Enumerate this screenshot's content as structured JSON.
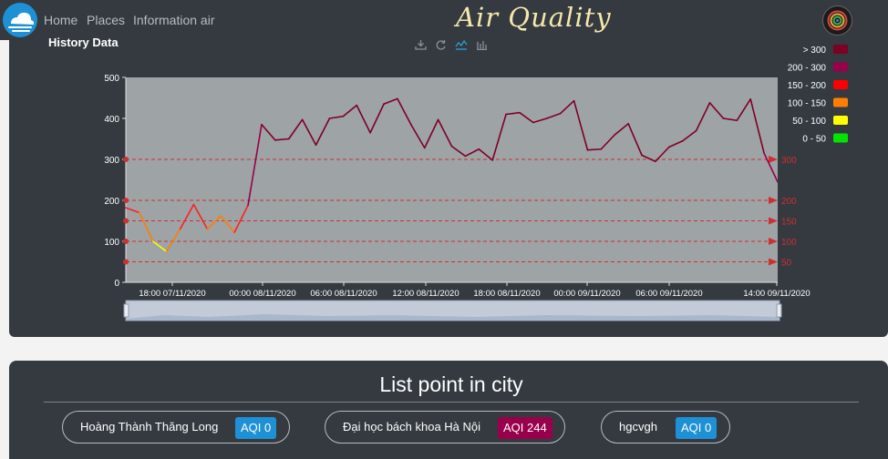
{
  "navbar": {
    "links": [
      "Home",
      "Places",
      "Information air"
    ],
    "brand": "Air Quality"
  },
  "history": {
    "title": "History Data",
    "toolbox": [
      "download-icon",
      "refresh-icon",
      "line-chart-icon",
      "bar-chart-icon"
    ]
  },
  "chart_data": {
    "type": "line",
    "y_ticks": [
      0,
      100,
      200,
      300,
      400,
      500
    ],
    "ylim": [
      0,
      500
    ],
    "x_tick_labels": [
      "18:00 07/11/2020",
      "00:00 08/11/2020",
      "06:00 08/11/2020",
      "12:00 08/11/2020",
      "18:00 08/11/2020",
      "00:00 09/11/2020",
      "06:00 09/11/2020",
      "14:00 09/11/2020"
    ],
    "values": [
      182,
      170,
      100,
      75,
      130,
      190,
      130,
      162,
      122,
      188,
      385,
      347,
      350,
      397,
      335,
      400,
      405,
      432,
      365,
      435,
      448,
      385,
      328,
      397,
      332,
      308,
      325,
      298,
      410,
      414,
      390,
      400,
      412,
      443,
      323,
      325,
      360,
      387,
      310,
      295,
      330,
      345,
      370,
      438,
      400,
      395,
      447,
      315,
      245
    ],
    "mark_lines": [
      {
        "value": 300,
        "label": "300"
      },
      {
        "value": 200,
        "label": "200"
      },
      {
        "value": 150,
        "label": "150"
      },
      {
        "value": 100,
        "label": "100"
      },
      {
        "value": 50,
        "label": "50"
      }
    ],
    "legend": [
      {
        "label": "> 300",
        "color": "#7e0023"
      },
      {
        "label": "200 - 300",
        "color": "#99004c"
      },
      {
        "label": "150 - 200",
        "color": "#ff0000"
      },
      {
        "label": "100 - 150",
        "color": "#ff7e00"
      },
      {
        "label": "50 - 100",
        "color": "#ffff00"
      },
      {
        "label": "0 - 50",
        "color": "#00e400"
      }
    ],
    "legend_position": "right",
    "grid": false
  },
  "list": {
    "title": "List point in city",
    "points": [
      {
        "name": "Hoàng Thành Thăng Long",
        "aqi": "AQI 0",
        "color": "#1e90d6"
      },
      {
        "name": "Đại học bách khoa Hà Nội",
        "aqi": "AQI 244",
        "color": "#99004c"
      },
      {
        "name": "hgcvgh",
        "aqi": "AQI 0",
        "color": "#1e90d6"
      }
    ]
  },
  "colors": {
    "navbar": "#343a40",
    "panel": "#343a40",
    "plot_bg": "#9ea3a6",
    "mark_line": "#cf2f2f"
  }
}
